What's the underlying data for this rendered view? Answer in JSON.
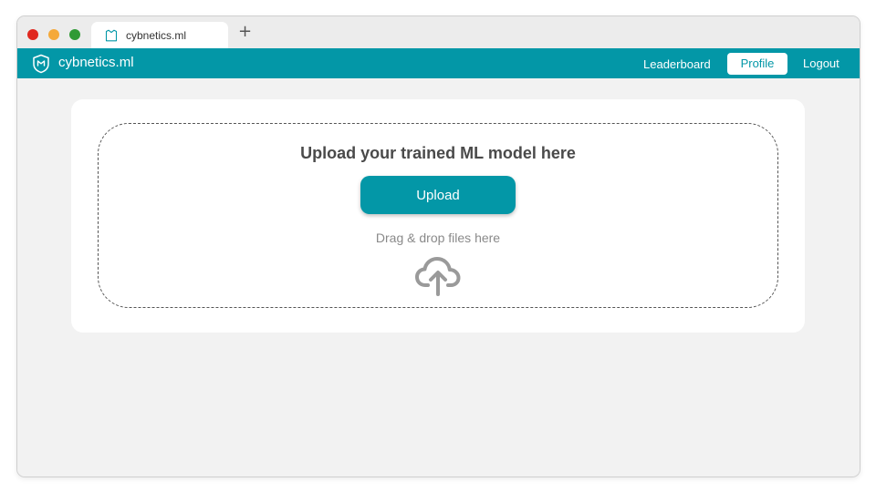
{
  "browser": {
    "tab_title": "cybnetics.ml",
    "new_tab_symbol": "+",
    "tab_icon": "shield-icon",
    "window_controls": [
      "close",
      "minimize",
      "maximize"
    ]
  },
  "navbar": {
    "brand_name": "cybnetics.ml",
    "brand_icon": "shield-icon",
    "links": {
      "leaderboard": "Leaderboard",
      "profile": "Profile",
      "logout": "Logout"
    },
    "active_link": "profile",
    "color": "#0397a7"
  },
  "upload": {
    "heading": "Upload your trained ML model here",
    "button_label": "Upload",
    "hint": "Drag & drop files here",
    "icon": "cloud-upload-icon"
  },
  "colors": {
    "accent": "#0397a7",
    "background": "#f2f2f2",
    "card": "#ffffff"
  }
}
